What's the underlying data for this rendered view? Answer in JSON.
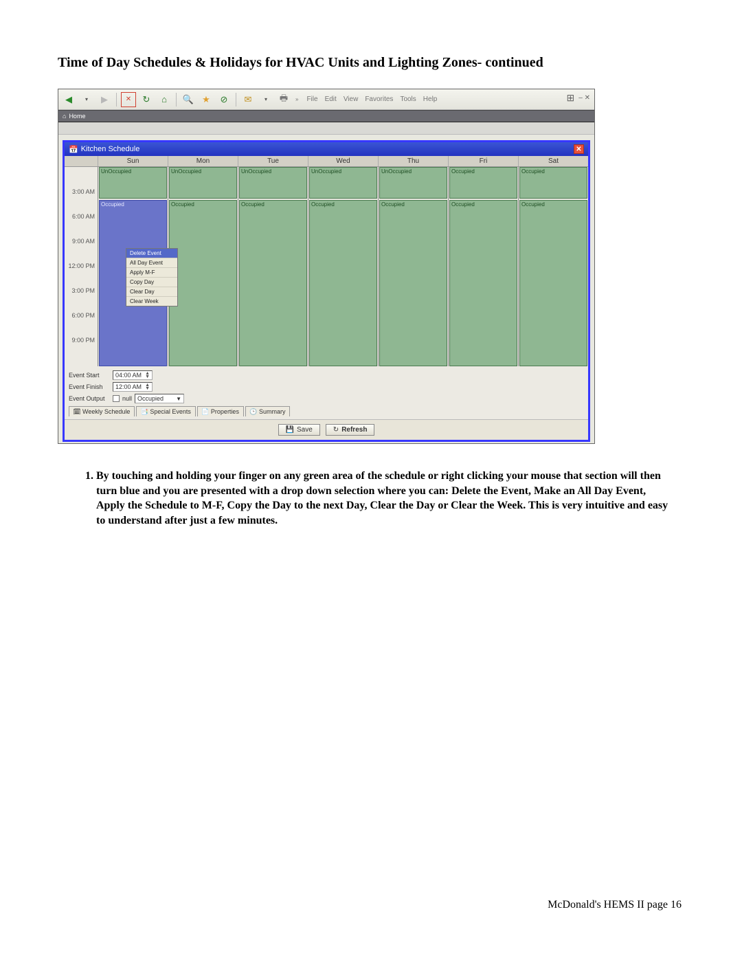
{
  "doc": {
    "title": "Time of Day Schedules & Holidays for HVAC Units and Lighting Zones- continued",
    "instruction_number": "1.",
    "instruction_text": "By touching and holding your finger on any green area of the schedule or right clicking your mouse that section will then turn blue and you are presented with a drop down selection where you can: Delete the Event, Make an All Day Event, Apply the Schedule to M-F, Copy the Day to the next Day, Clear the Day or Clear the Week. This is very intuitive and easy to understand after just a few minutes.",
    "footer": "McDonald's HEMS II page 16"
  },
  "ie": {
    "menu": [
      "File",
      "Edit",
      "View",
      "Favorites",
      "Tools",
      "Help"
    ],
    "addr_icon": "⌂",
    "addr_text": "Home",
    "right_controls": "–  ✕"
  },
  "window": {
    "title": "Kitchen Schedule",
    "close": "✕"
  },
  "schedule": {
    "days": [
      "Sun",
      "Mon",
      "Tue",
      "Wed",
      "Thu",
      "Fri",
      "Sat"
    ],
    "time_labels": [
      "3:00 AM",
      "6:00 AM",
      "9:00 AM",
      "12:00 PM",
      "3:00 PM",
      "6:00 PM",
      "9:00 PM"
    ],
    "unoccupied_label": "UnOccupied",
    "occupied_label": "Occupied",
    "columns": [
      {
        "top_state": "UnOccupied",
        "occ_start": 48
      },
      {
        "top_state": "UnOccupied",
        "occ_start": 48
      },
      {
        "top_state": "UnOccupied",
        "occ_start": 48
      },
      {
        "top_state": "UnOccupied",
        "occ_start": 48
      },
      {
        "top_state": "UnOccupied",
        "occ_start": 48
      },
      {
        "top_state": "Occupied",
        "occ_start": 0
      },
      {
        "top_state": "Occupied",
        "occ_start": 0
      }
    ]
  },
  "context_menu": {
    "items": [
      "Delete Event",
      "All Day Event",
      "Apply M-F",
      "Copy Day",
      "Clear Day",
      "Clear Week"
    ],
    "highlighted_index": 0
  },
  "controls": {
    "event_start_label": "Event Start",
    "event_start_value": "04:00 AM",
    "event_finish_label": "Event Finish",
    "event_finish_value": "12:00 AM",
    "event_output_label": "Event Output",
    "event_output_null": "null",
    "event_output_value": "Occupied"
  },
  "tabs": {
    "weekly": "Weekly Schedule",
    "special": "Special Events",
    "properties": "Properties",
    "summary": "Summary"
  },
  "buttons": {
    "save": "Save",
    "refresh": "Refresh"
  }
}
